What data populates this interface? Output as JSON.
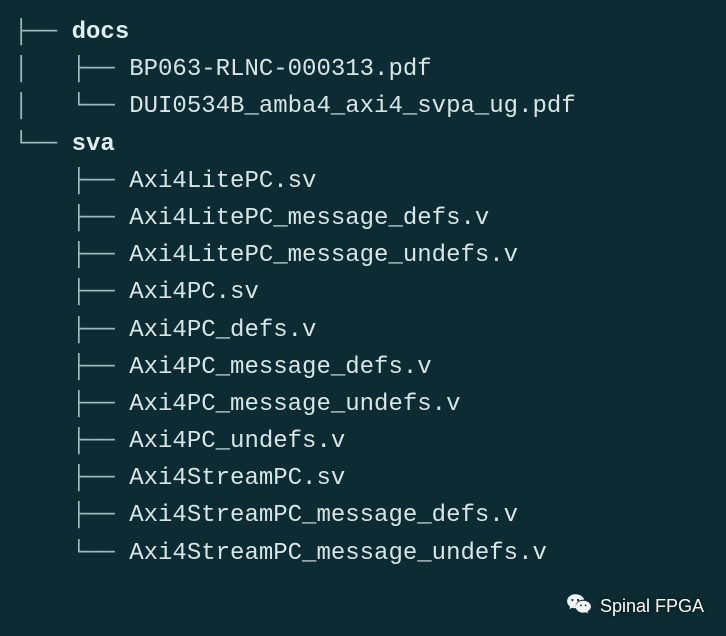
{
  "tree": {
    "glyphs": {
      "tee": "├── ",
      "elbow": "└── ",
      "pipe": "│   ",
      "space": "    "
    },
    "nodes": [
      {
        "prefix": "tee",
        "indent": "",
        "label": "docs",
        "dir": true
      },
      {
        "prefix": "tee",
        "indent": "pipe",
        "label": "BP063-RLNC-000313.pdf",
        "dir": false
      },
      {
        "prefix": "elbow",
        "indent": "pipe",
        "label": "DUI0534B_amba4_axi4_svpa_ug.pdf",
        "dir": false
      },
      {
        "prefix": "elbow",
        "indent": "",
        "label": "sva",
        "dir": true
      },
      {
        "prefix": "tee",
        "indent": "space",
        "label": "Axi4LitePC.sv",
        "dir": false
      },
      {
        "prefix": "tee",
        "indent": "space",
        "label": "Axi4LitePC_message_defs.v",
        "dir": false
      },
      {
        "prefix": "tee",
        "indent": "space",
        "label": "Axi4LitePC_message_undefs.v",
        "dir": false
      },
      {
        "prefix": "tee",
        "indent": "space",
        "label": "Axi4PC.sv",
        "dir": false
      },
      {
        "prefix": "tee",
        "indent": "space",
        "label": "Axi4PC_defs.v",
        "dir": false
      },
      {
        "prefix": "tee",
        "indent": "space",
        "label": "Axi4PC_message_defs.v",
        "dir": false
      },
      {
        "prefix": "tee",
        "indent": "space",
        "label": "Axi4PC_message_undefs.v",
        "dir": false
      },
      {
        "prefix": "tee",
        "indent": "space",
        "label": "Axi4PC_undefs.v",
        "dir": false
      },
      {
        "prefix": "tee",
        "indent": "space",
        "label": "Axi4StreamPC.sv",
        "dir": false
      },
      {
        "prefix": "tee",
        "indent": "space",
        "label": "Axi4StreamPC_message_defs.v",
        "dir": false
      },
      {
        "prefix": "elbow",
        "indent": "space",
        "label": "Axi4StreamPC_message_undefs.v",
        "dir": false
      }
    ]
  },
  "watermark": {
    "text": "Spinal FPGA"
  }
}
